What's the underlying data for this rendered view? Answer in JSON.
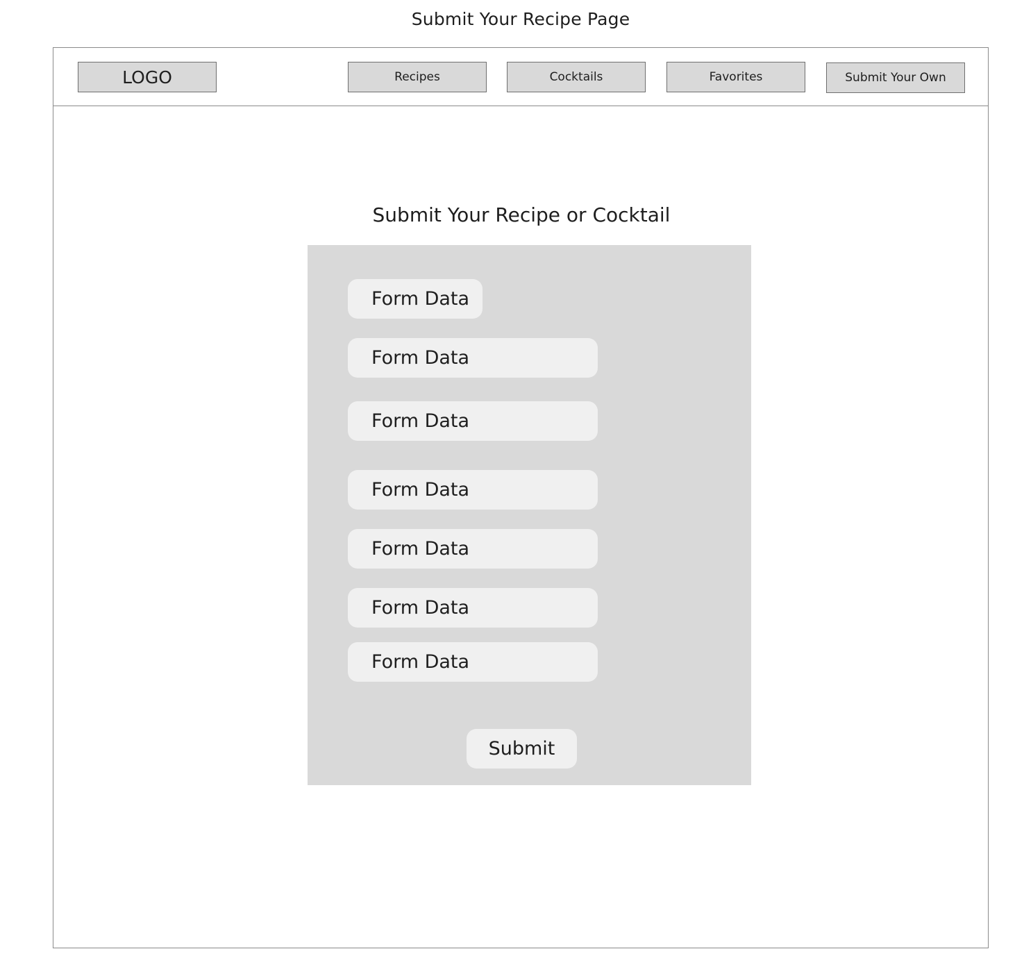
{
  "page_caption": "Submit Your Recipe Page",
  "navbar": {
    "logo": "LOGO",
    "items": [
      {
        "label": "Recipes"
      },
      {
        "label": "Cocktails"
      },
      {
        "label": "Favorites"
      },
      {
        "label": "Submit Your Own"
      }
    ]
  },
  "form": {
    "title": "Submit Your Recipe or Cocktail",
    "fields": [
      {
        "value": "Form Data"
      },
      {
        "value": "Form Data"
      },
      {
        "value": "Form Data"
      },
      {
        "value": "Form Data"
      },
      {
        "value": "Form Data"
      },
      {
        "value": "Form Data"
      },
      {
        "value": "Form Data"
      }
    ],
    "submit_label": "Submit"
  },
  "colors": {
    "panel": "#d9d9d9",
    "field": "#f0f0f0",
    "nav_button": "#d9d9d9",
    "text": "#1e1e1e"
  }
}
